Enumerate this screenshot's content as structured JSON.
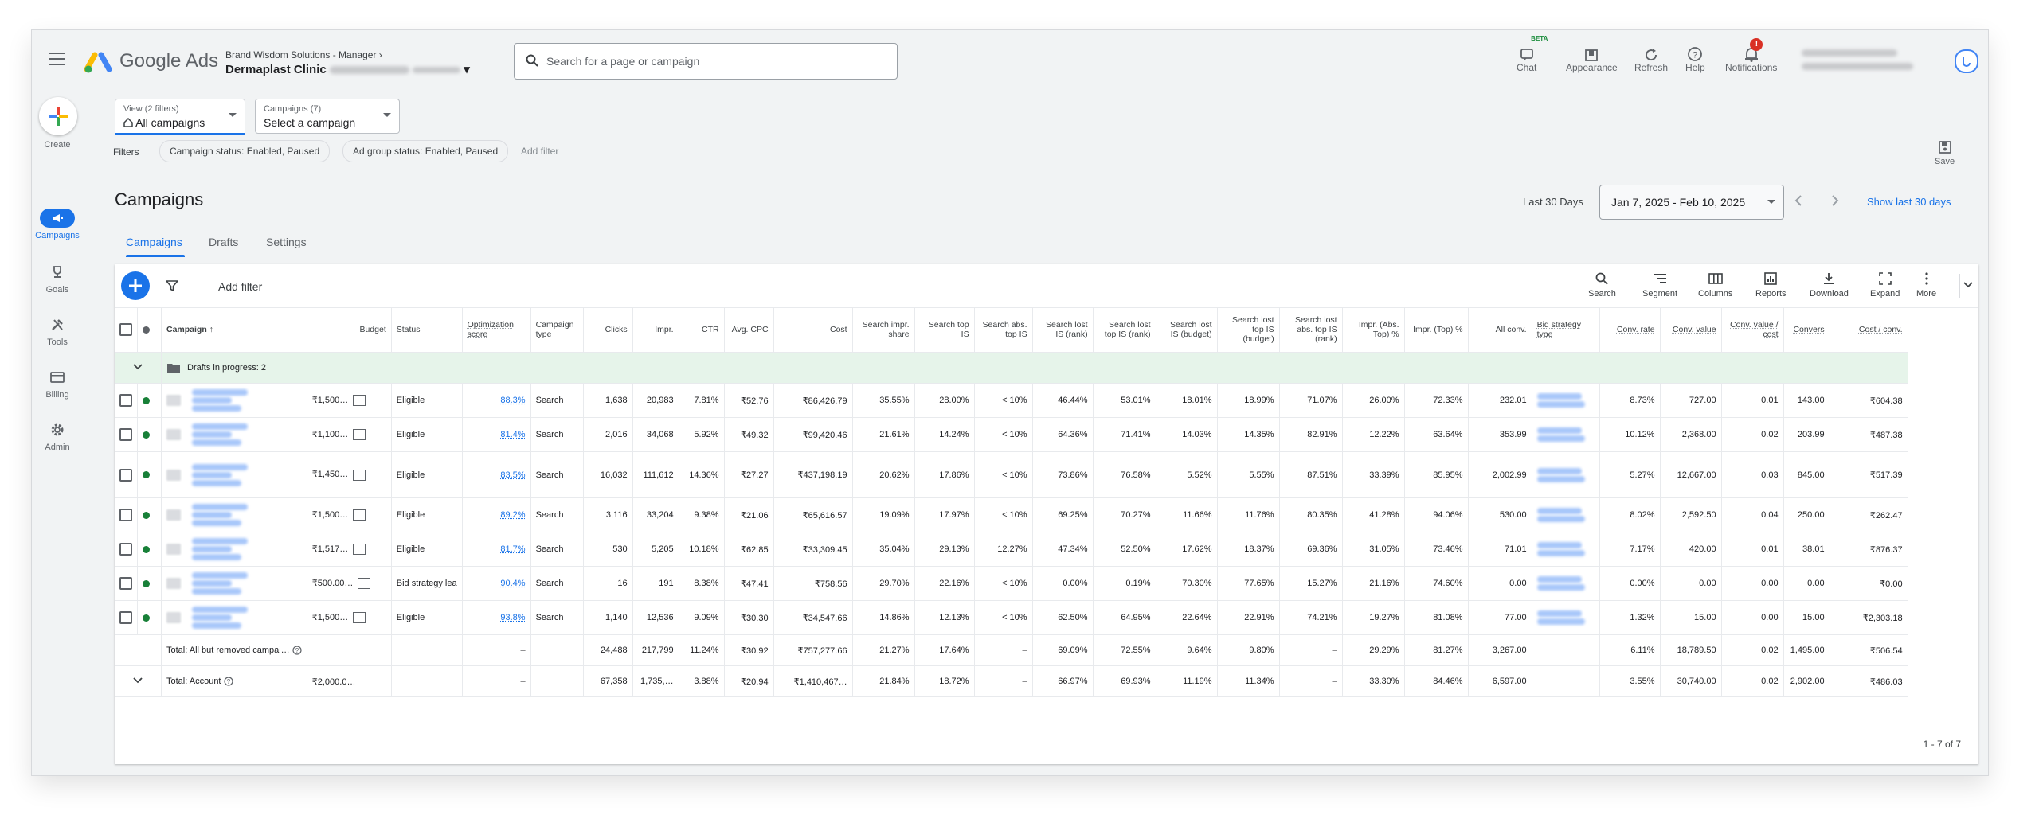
{
  "app": {
    "name": "Google Ads"
  },
  "header": {
    "manager_account": "Brand Wisdom Solutions - Manager",
    "account_name": "Dermaplast Clinic",
    "search_placeholder": "Search for a page or campaign",
    "tools": [
      {
        "label": "Chat",
        "icon": "chat-icon",
        "beta": "BETA"
      },
      {
        "label": "Appearance",
        "icon": "appearance-icon"
      },
      {
        "label": "Refresh",
        "icon": "refresh-icon"
      },
      {
        "label": "Help",
        "icon": "help-icon"
      },
      {
        "label": "Notifications",
        "icon": "bell-icon",
        "badge": "!"
      }
    ]
  },
  "sidenav": {
    "create": "Create",
    "items": [
      {
        "label": "Campaigns",
        "icon": "megaphone-icon",
        "active": true
      },
      {
        "label": "Goals",
        "icon": "trophy-icon"
      },
      {
        "label": "Tools",
        "icon": "tools-icon"
      },
      {
        "label": "Billing",
        "icon": "card-icon"
      },
      {
        "label": "Admin",
        "icon": "gear-icon"
      }
    ]
  },
  "view_selector": {
    "small": "View (2 filters)",
    "value": "All campaigns"
  },
  "campaign_selector": {
    "small": "Campaigns (7)",
    "value": "Select a campaign"
  },
  "filters": {
    "label": "Filters",
    "chips": [
      "Campaign status: Enabled, Paused",
      "Ad group status: Enabled, Paused"
    ],
    "add": "Add filter"
  },
  "save_label": "Save",
  "page": {
    "title": "Campaigns",
    "date_label": "Last 30 Days",
    "date_range": "Jan 7, 2025 - Feb 10, 2025",
    "show_last": "Show last 30 days",
    "tabs": [
      "Campaigns",
      "Drafts",
      "Settings"
    ]
  },
  "table_toolbar": {
    "add_filter": "Add filter",
    "tools": [
      {
        "label": "Search",
        "icon": "search-icon"
      },
      {
        "label": "Segment",
        "icon": "segment-icon"
      },
      {
        "label": "Columns",
        "icon": "columns-icon"
      },
      {
        "label": "Reports",
        "icon": "reports-icon"
      },
      {
        "label": "Download",
        "icon": "download-icon"
      },
      {
        "label": "Expand",
        "icon": "expand-icon"
      },
      {
        "label": "More",
        "icon": "more-icon"
      }
    ]
  },
  "table": {
    "headers": [
      "Campaign",
      "Budget",
      "Status",
      "Optimization score",
      "Campaign type",
      "Clicks",
      "Impr.",
      "CTR",
      "Avg. CPC",
      "Cost",
      "Search impr. share",
      "Search top IS",
      "Search abs. top IS",
      "Search lost IS (rank)",
      "Search lost top IS (rank)",
      "Search lost IS (budget)",
      "Search lost top IS (budget)",
      "Search lost abs. top IS (rank)",
      "Impr. (Abs. Top) %",
      "Impr. (Top) %",
      "All conv.",
      "Bid strategy type",
      "Conv. rate",
      "Conv. value",
      "Conv. value / cost",
      "Convers",
      "Cost / conv."
    ],
    "draft_row": "Drafts in progress: 2",
    "rows": [
      {
        "budget": "₹1,500…",
        "status": "Eligible",
        "opt": "88.3%",
        "type": "Search",
        "clicks": "1,638",
        "impr": "20,983",
        "ctr": "7.81%",
        "cpc": "₹52.76",
        "cost": "₹86,426.79",
        "sis": "35.55%",
        "stis": "28.00%",
        "satis": "< 10%",
        "slr": "46.44%",
        "sltr": "53.01%",
        "slb": "18.01%",
        "sltb": "18.99%",
        "slatr": "71.07%",
        "iat": "26.00%",
        "it": "72.33%",
        "allconv": "232.01",
        "cr": "8.73%",
        "cv": "727.00",
        "cvc": "0.01",
        "conv": "143.00",
        "cpconv": "₹604.38"
      },
      {
        "budget": "₹1,100…",
        "status": "Eligible",
        "opt": "81.4%",
        "type": "Search",
        "clicks": "2,016",
        "impr": "34,068",
        "ctr": "5.92%",
        "cpc": "₹49.32",
        "cost": "₹99,420.46",
        "sis": "21.61%",
        "stis": "14.24%",
        "satis": "< 10%",
        "slr": "64.36%",
        "sltr": "71.41%",
        "slb": "14.03%",
        "sltb": "14.35%",
        "slatr": "82.91%",
        "iat": "12.22%",
        "it": "63.64%",
        "allconv": "353.99",
        "cr": "10.12%",
        "cv": "2,368.00",
        "cvc": "0.02",
        "conv": "203.99",
        "cpconv": "₹487.38"
      },
      {
        "budget": "₹1,450…",
        "status": "Eligible",
        "opt": "83.5%",
        "type": "Search",
        "clicks": "16,032",
        "impr": "111,612",
        "ctr": "14.36%",
        "cpc": "₹27.27",
        "cost": "₹437,198.19",
        "sis": "20.62%",
        "stis": "17.86%",
        "satis": "< 10%",
        "slr": "73.86%",
        "sltr": "76.58%",
        "slb": "5.52%",
        "sltb": "5.55%",
        "slatr": "87.51%",
        "iat": "33.39%",
        "it": "85.95%",
        "allconv": "2,002.99",
        "cr": "5.27%",
        "cv": "12,667.00",
        "cvc": "0.03",
        "conv": "845.00",
        "cpconv": "₹517.39"
      },
      {
        "budget": "₹1,500…",
        "status": "Eligible",
        "opt": "89.2%",
        "type": "Search",
        "clicks": "3,116",
        "impr": "33,204",
        "ctr": "9.38%",
        "cpc": "₹21.06",
        "cost": "₹65,616.57",
        "sis": "19.09%",
        "stis": "17.97%",
        "satis": "< 10%",
        "slr": "69.25%",
        "sltr": "70.27%",
        "slb": "11.66%",
        "sltb": "11.76%",
        "slatr": "80.35%",
        "iat": "41.28%",
        "it": "94.06%",
        "allconv": "530.00",
        "cr": "8.02%",
        "cv": "2,592.50",
        "cvc": "0.04",
        "conv": "250.00",
        "cpconv": "₹262.47"
      },
      {
        "budget": "₹1,517…",
        "status": "Eligible",
        "opt": "81.7%",
        "type": "Search",
        "clicks": "530",
        "impr": "5,205",
        "ctr": "10.18%",
        "cpc": "₹62.85",
        "cost": "₹33,309.45",
        "sis": "35.04%",
        "stis": "29.13%",
        "satis": "12.27%",
        "slr": "47.34%",
        "sltr": "52.50%",
        "slb": "17.62%",
        "sltb": "18.37%",
        "slatr": "69.36%",
        "iat": "31.05%",
        "it": "73.46%",
        "allconv": "71.01",
        "cr": "7.17%",
        "cv": "420.00",
        "cvc": "0.01",
        "conv": "38.01",
        "cpconv": "₹876.37"
      },
      {
        "budget": "₹500.00…",
        "status": "Bid strategy lea",
        "opt": "90.4%",
        "type": "Search",
        "clicks": "16",
        "impr": "191",
        "ctr": "8.38%",
        "cpc": "₹47.41",
        "cost": "₹758.56",
        "sis": "29.70%",
        "stis": "22.16%",
        "satis": "< 10%",
        "slr": "0.00%",
        "sltr": "0.19%",
        "slb": "70.30%",
        "sltb": "77.65%",
        "slatr": "15.27%",
        "iat": "21.16%",
        "it": "74.60%",
        "allconv": "0.00",
        "cr": "0.00%",
        "cv": "0.00",
        "cvc": "0.00",
        "conv": "0.00",
        "cpconv": "₹0.00"
      },
      {
        "budget": "₹1,500…",
        "status": "Eligible",
        "opt": "93.8%",
        "type": "Search",
        "clicks": "1,140",
        "impr": "12,536",
        "ctr": "9.09%",
        "cpc": "₹30.30",
        "cost": "₹34,547.66",
        "sis": "14.86%",
        "stis": "12.13%",
        "satis": "< 10%",
        "slr": "62.50%",
        "sltr": "64.95%",
        "slb": "22.64%",
        "sltb": "22.91%",
        "slatr": "74.21%",
        "iat": "19.27%",
        "it": "81.08%",
        "allconv": "77.00",
        "cr": "1.32%",
        "cv": "15.00",
        "cvc": "0.00",
        "conv": "15.00",
        "cpconv": "₹2,303.18"
      }
    ],
    "totals": [
      {
        "label": "Total: All but removed campai…",
        "budget": "",
        "opt": "–",
        "clicks": "24,488",
        "impr": "217,799",
        "ctr": "11.24%",
        "cpc": "₹30.92",
        "cost": "₹757,277.66",
        "sis": "21.27%",
        "stis": "17.64%",
        "satis": "–",
        "slr": "69.09%",
        "sltr": "72.55%",
        "slb": "9.64%",
        "sltb": "9.80%",
        "slatr": "–",
        "iat": "29.29%",
        "it": "81.27%",
        "allconv": "3,267.00",
        "cr": "6.11%",
        "cv": "18,789.50",
        "cvc": "0.02",
        "conv": "1,495.00",
        "cpconv": "₹506.54"
      },
      {
        "label": "Total: Account",
        "budget": "₹2,000.0…",
        "opt": "–",
        "clicks": "67,358",
        "impr": "1,735,…",
        "ctr": "3.88%",
        "cpc": "₹20.94",
        "cost": "₹1,410,467…",
        "sis": "21.84%",
        "stis": "18.72%",
        "satis": "–",
        "slr": "66.97%",
        "sltr": "69.93%",
        "slb": "11.19%",
        "sltb": "11.34%",
        "slatr": "–",
        "iat": "33.30%",
        "it": "84.46%",
        "allconv": "6,597.00",
        "cr": "3.55%",
        "cv": "30,740.00",
        "cvc": "0.02",
        "conv": "2,902.00",
        "cpconv": "₹486.03"
      }
    ],
    "pager": "1 - 7 of 7"
  },
  "colors": {
    "brand_blue": "#1a73e8",
    "enabled_green": "#188038",
    "draft_bg": "#e6f4ea"
  }
}
